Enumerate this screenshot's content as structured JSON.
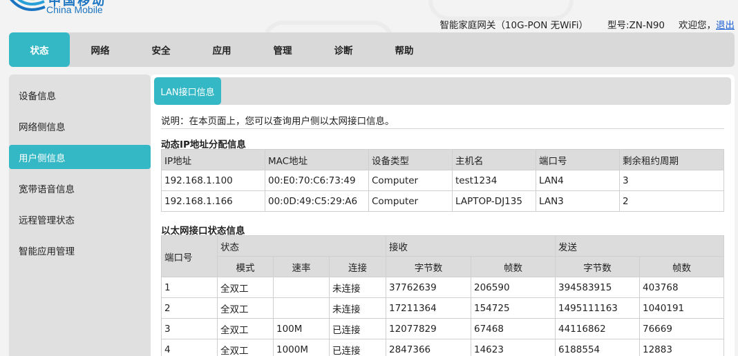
{
  "header": {
    "brand_cn": "中国移动",
    "brand_en": "China Mobile",
    "gateway": "智能家庭网关（10G-PON 无WiFi）",
    "model": "型号:ZN-N90",
    "welcome": "欢迎您，",
    "logout": "退出"
  },
  "nav": [
    "状态",
    "网络",
    "安全",
    "应用",
    "管理",
    "诊断",
    "帮助"
  ],
  "sidebar": [
    "设备信息",
    "网络侧信息",
    "用户侧信息",
    "宽带语音信息",
    "远程管理状态",
    "智能应用管理"
  ],
  "tab": "LAN接口信息",
  "description": "说明：在本页面上，您可以查询用户侧以太网接口信息。",
  "dhcp": {
    "title": "动态IP地址分配信息",
    "headers": [
      "IP地址",
      "MAC地址",
      "设备类型",
      "主机名",
      "端口号",
      "剩余租约周期"
    ],
    "rows": [
      [
        "192.168.1.100",
        "00:E0:70:C6:73:49",
        "Computer",
        "test1234",
        "LAN4",
        "3"
      ],
      [
        "192.168.1.166",
        "00:0D:49:C5:29:A6",
        "Computer",
        "LAPTOP-DJ135",
        "LAN3",
        "2"
      ]
    ]
  },
  "eth": {
    "title": "以太网接口状态信息",
    "port_header": "端口号",
    "status_header": "状态",
    "rx_header": "接收",
    "tx_header": "发送",
    "sub_headers": [
      "模式",
      "速率",
      "连接",
      "字节数",
      "帧数",
      "字节数",
      "帧数"
    ],
    "rows": [
      [
        "1",
        "全双工",
        "",
        "未连接",
        "37762639",
        "206590",
        "394583915",
        "403768"
      ],
      [
        "2",
        "全双工",
        "",
        "未连接",
        "17211364",
        "154725",
        "1495111163",
        "1040191"
      ],
      [
        "3",
        "全双工",
        "100M",
        "已连接",
        "12077829",
        "67468",
        "44116862",
        "76669"
      ],
      [
        "4",
        "全双工",
        "1000M",
        "已连接",
        "2847366",
        "14623",
        "6188554",
        "12883"
      ]
    ]
  },
  "colors": {
    "accent": "#35b8c5",
    "brand": "#1a74c2",
    "link": "#1a5fd6"
  }
}
